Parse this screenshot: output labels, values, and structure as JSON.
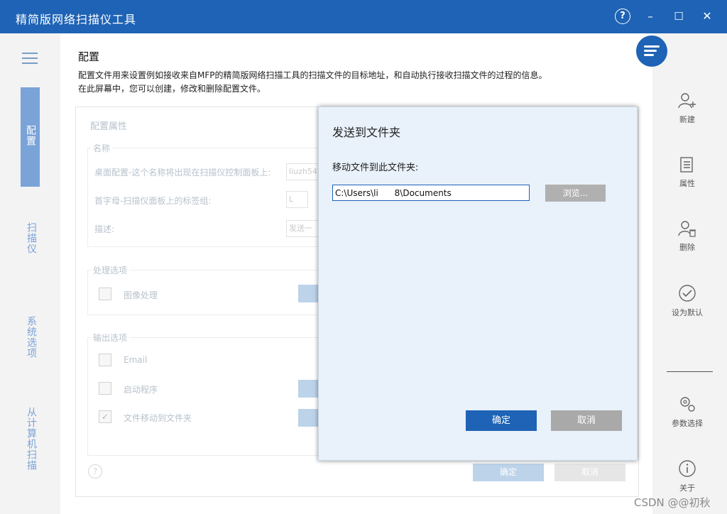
{
  "window": {
    "title": "精简版网络扫描仪工具",
    "help": "?",
    "minimize": "–",
    "maximize": "☐",
    "close": "✕"
  },
  "nav": {
    "items": [
      {
        "label": "配置",
        "active": true
      },
      {
        "label": "扫描仪"
      },
      {
        "label": "系统选项"
      },
      {
        "label": "从计算机扫描"
      }
    ]
  },
  "page": {
    "title": "配置",
    "description_line1": "配置文件用来设置例如接收来自MFP的精简版网络扫描工具的扫描文件的目标地址，和自动执行接收扫描文件的过程的信息。",
    "description_line2": "在此屏幕中，您可以创建，修改和删除配置文件。"
  },
  "panel": {
    "title": "配置属性",
    "name_group": "名称",
    "desktop_label": "桌面配置-这个名称将出现在扫描仪控制面板上:",
    "desktop_value": "liuzh54",
    "initial_label": "首字母-扫描仪面板上的标签组:",
    "initial_value": "L",
    "desc_label": "描述:",
    "desc_value": "发送一",
    "processing_group": "处理选项",
    "image_processing": "图像处理",
    "output_group": "输出选项",
    "email": "Email",
    "launch_program": "启动程序",
    "move_to_folder": "文件移动到文件夹",
    "help_icon": "?",
    "ok": "确定",
    "cancel": "取消"
  },
  "right_actions": {
    "new": "新建",
    "properties": "属性",
    "delete": "删除",
    "set_default": "设为默认",
    "parameters": "参数选择",
    "about": "关于"
  },
  "dialog": {
    "title": "发送到文件夹",
    "label": "移动文件到此文件夹:",
    "path_value": "C:\\Users\\li      8\\Documents",
    "browse": "浏览...",
    "ok": "确定",
    "cancel": "取消"
  },
  "watermark": "CSDN @@初秋",
  "colors": {
    "accent": "#1e63b5",
    "nav_active": "#7aa3d8",
    "dialog_bg": "#e9f1fa"
  }
}
